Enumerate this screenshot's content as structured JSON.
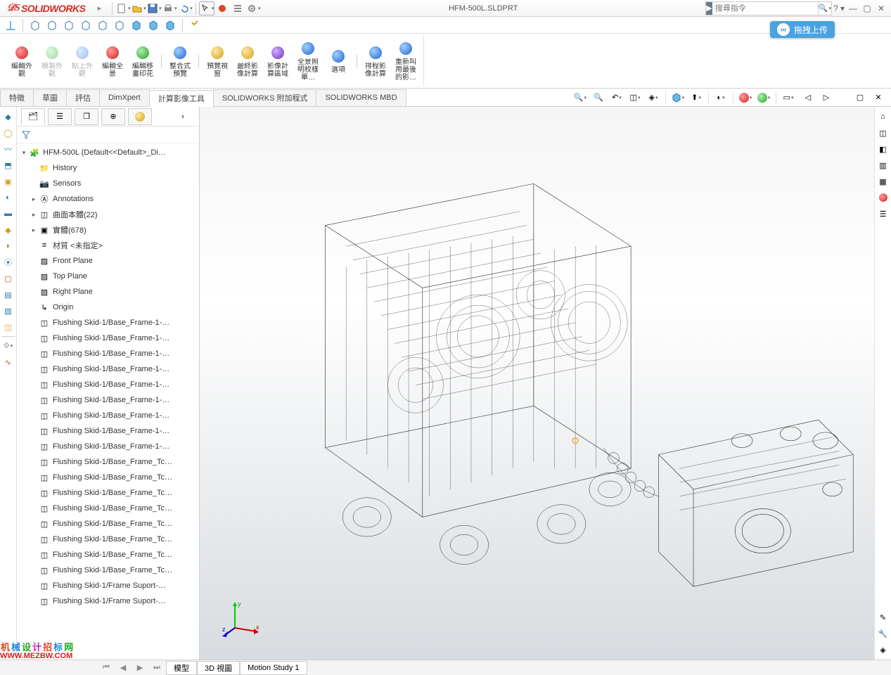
{
  "app": {
    "name": "SOLIDWORKS",
    "document_title": "HFM-500L.SLDPRT",
    "search_placeholder": "搜尋指令"
  },
  "upload_badge": "拖拽上传",
  "ribbon": [
    {
      "label": "編輯外\n觀",
      "icon": "sph-r"
    },
    {
      "label": "模製外\n觀",
      "icon": "sph-g",
      "disabled": true
    },
    {
      "label": "貼上外\n觀",
      "icon": "sph-b",
      "disabled": true
    },
    {
      "label": "編輯全\n景",
      "icon": "sph-r"
    },
    {
      "label": "編輯移\n畫印花",
      "icon": "sph-g"
    },
    {
      "label": "整合式\n預覽",
      "icon": "sph-b"
    },
    {
      "label": "預覽視\n窗",
      "icon": "sph-y"
    },
    {
      "label": "最終影\n像計算",
      "icon": "sph-y"
    },
    {
      "label": "影像計\n算區域",
      "icon": "sph-p"
    },
    {
      "label": "全景照\n明校樣\n單…",
      "icon": "sph-b"
    },
    {
      "label": "選項",
      "icon": "sph-b"
    },
    {
      "label": "排程影\n像計算",
      "icon": "sph-b"
    },
    {
      "label": "重新叫\n用最後\n的影…",
      "icon": "sph-b"
    }
  ],
  "tabs": [
    "特徵",
    "草圖",
    "評估",
    "DimXpert",
    "計算影像工具",
    "SOLIDWORKS 附加程式",
    "SOLIDWORKS MBD"
  ],
  "active_tab": "計算影像工具",
  "tree_root": "HFM-500L  (Default<<Default>_Di…",
  "tree": [
    {
      "label": "History",
      "indent": 1,
      "icon": "folder"
    },
    {
      "label": "Sensors",
      "indent": 1,
      "icon": "sensor"
    },
    {
      "label": "Annotations",
      "indent": 1,
      "icon": "annot",
      "exp": "▸"
    },
    {
      "label": "曲面本體(22)",
      "indent": 1,
      "icon": "surf",
      "exp": "▸"
    },
    {
      "label": "實體(678)",
      "indent": 1,
      "icon": "solid",
      "exp": "▸"
    },
    {
      "label": "材質 <未指定>",
      "indent": 1,
      "icon": "mat"
    },
    {
      "label": "Front Plane",
      "indent": 1,
      "icon": "plane"
    },
    {
      "label": "Top Plane",
      "indent": 1,
      "icon": "plane"
    },
    {
      "label": "Right Plane",
      "indent": 1,
      "icon": "plane"
    },
    {
      "label": "Origin",
      "indent": 1,
      "icon": "origin"
    },
    {
      "label": "Flushing Skid-1/Base_Frame-1-…",
      "indent": 1,
      "icon": "feat"
    },
    {
      "label": "Flushing Skid-1/Base_Frame-1-…",
      "indent": 1,
      "icon": "feat"
    },
    {
      "label": "Flushing Skid-1/Base_Frame-1-…",
      "indent": 1,
      "icon": "feat"
    },
    {
      "label": "Flushing Skid-1/Base_Frame-1-…",
      "indent": 1,
      "icon": "feat"
    },
    {
      "label": "Flushing Skid-1/Base_Frame-1-…",
      "indent": 1,
      "icon": "feat"
    },
    {
      "label": "Flushing Skid-1/Base_Frame-1-…",
      "indent": 1,
      "icon": "feat"
    },
    {
      "label": "Flushing Skid-1/Base_Frame-1-…",
      "indent": 1,
      "icon": "feat"
    },
    {
      "label": "Flushing Skid-1/Base_Frame-1-…",
      "indent": 1,
      "icon": "feat"
    },
    {
      "label": "Flushing Skid-1/Base_Frame-1-…",
      "indent": 1,
      "icon": "feat"
    },
    {
      "label": "Flushing Skid-1/Base_Frame_Tc…",
      "indent": 1,
      "icon": "feat"
    },
    {
      "label": "Flushing Skid-1/Base_Frame_Tc…",
      "indent": 1,
      "icon": "feat"
    },
    {
      "label": "Flushing Skid-1/Base_Frame_Tc…",
      "indent": 1,
      "icon": "feat"
    },
    {
      "label": "Flushing Skid-1/Base_Frame_Tc…",
      "indent": 1,
      "icon": "feat"
    },
    {
      "label": "Flushing Skid-1/Base_Frame_Tc…",
      "indent": 1,
      "icon": "feat"
    },
    {
      "label": "Flushing Skid-1/Base_Frame_Tc…",
      "indent": 1,
      "icon": "feat"
    },
    {
      "label": "Flushing Skid-1/Base_Frame_Tc…",
      "indent": 1,
      "icon": "feat"
    },
    {
      "label": "Flushing Skid-1/Base_Frame_Tc…",
      "indent": 1,
      "icon": "feat"
    },
    {
      "label": "Flushing Skid-1/Frame Suport-…",
      "indent": 1,
      "icon": "feat"
    },
    {
      "label": "Flushing Skid-1/Frame Suport-…",
      "indent": 1,
      "icon": "feat"
    }
  ],
  "bottom_tabs": [
    "模型",
    "3D 視圖",
    "Motion Study 1"
  ],
  "triad": {
    "x": "x",
    "y": "y",
    "z": "z"
  },
  "watermark": {
    "line1": "机械设计招标网",
    "url": "WWW.MEZBW.COM"
  }
}
